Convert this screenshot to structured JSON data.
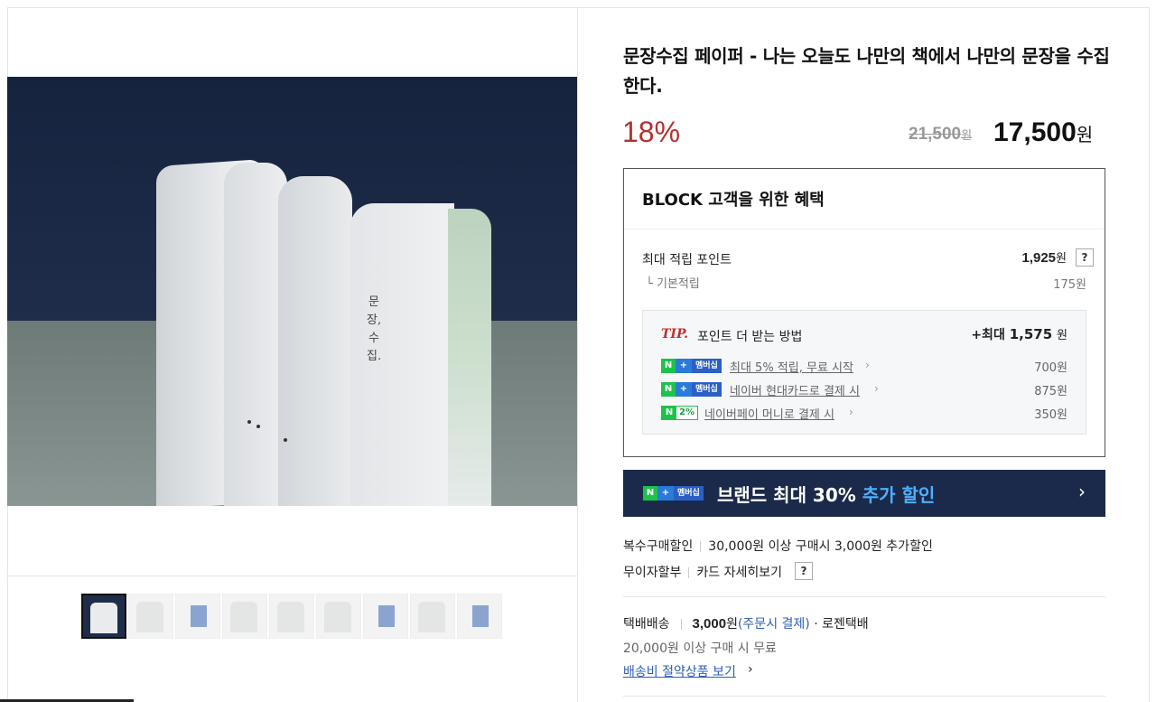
{
  "product": {
    "title": "문장수집 페이퍼 - 나는 오늘도 나만의 책에서 나만의 문장을 수집한다.",
    "discount": "18%",
    "original_price": "21,500",
    "sale_price": "17,500",
    "won": "원",
    "photo_text": "문장,수집."
  },
  "benefit": {
    "title": "BLOCK 고객을 위한 혜택",
    "max_points_label": "최대 적립 포인트",
    "max_points_value": "1,925",
    "help": "?",
    "base_label": "└ 기본적립",
    "base_value": "175원",
    "tip": {
      "mark": "TIP.",
      "text": "포인트 더 받는 방법",
      "total_prefix": "+최대",
      "total_value": "1,575",
      "rows": [
        {
          "link": "최대 5% 적립, 무료 시작",
          "amount": "700원"
        },
        {
          "link": "네이버 현대카드로 결제 시",
          "amount": "875원"
        },
        {
          "link": "네이버페이 머니로 결제 시",
          "amount": "350원"
        }
      ],
      "badge_n": "N",
      "badge_plus": "+",
      "badge_member": "멤버십",
      "badge_pct": "2%"
    }
  },
  "npay_banner": {
    "text": "브랜드 최대 30% ",
    "highlight": "추가 할인",
    "chevron": "›"
  },
  "purchase": {
    "multi_label": "복수구매할인",
    "multi_value": "30,000원 이상 구매시 3,000원 추가할인",
    "installment_label": "무이자할부",
    "installment_value": "카드 자세히보기"
  },
  "shipping": {
    "label": "택배배송",
    "fee": "3,000",
    "pay_note": "(주문시 결제)",
    "carrier": "· 로젠택배",
    "free_note": "20,000원 이상 구매 시 무료",
    "save_link": "배송비 절약상품 보기",
    "chevron": "›"
  },
  "colors": {
    "discount": "#b3312f",
    "banner": "#1b2a4a",
    "link": "#2d5fb5",
    "naver_green": "#1cc34b"
  }
}
